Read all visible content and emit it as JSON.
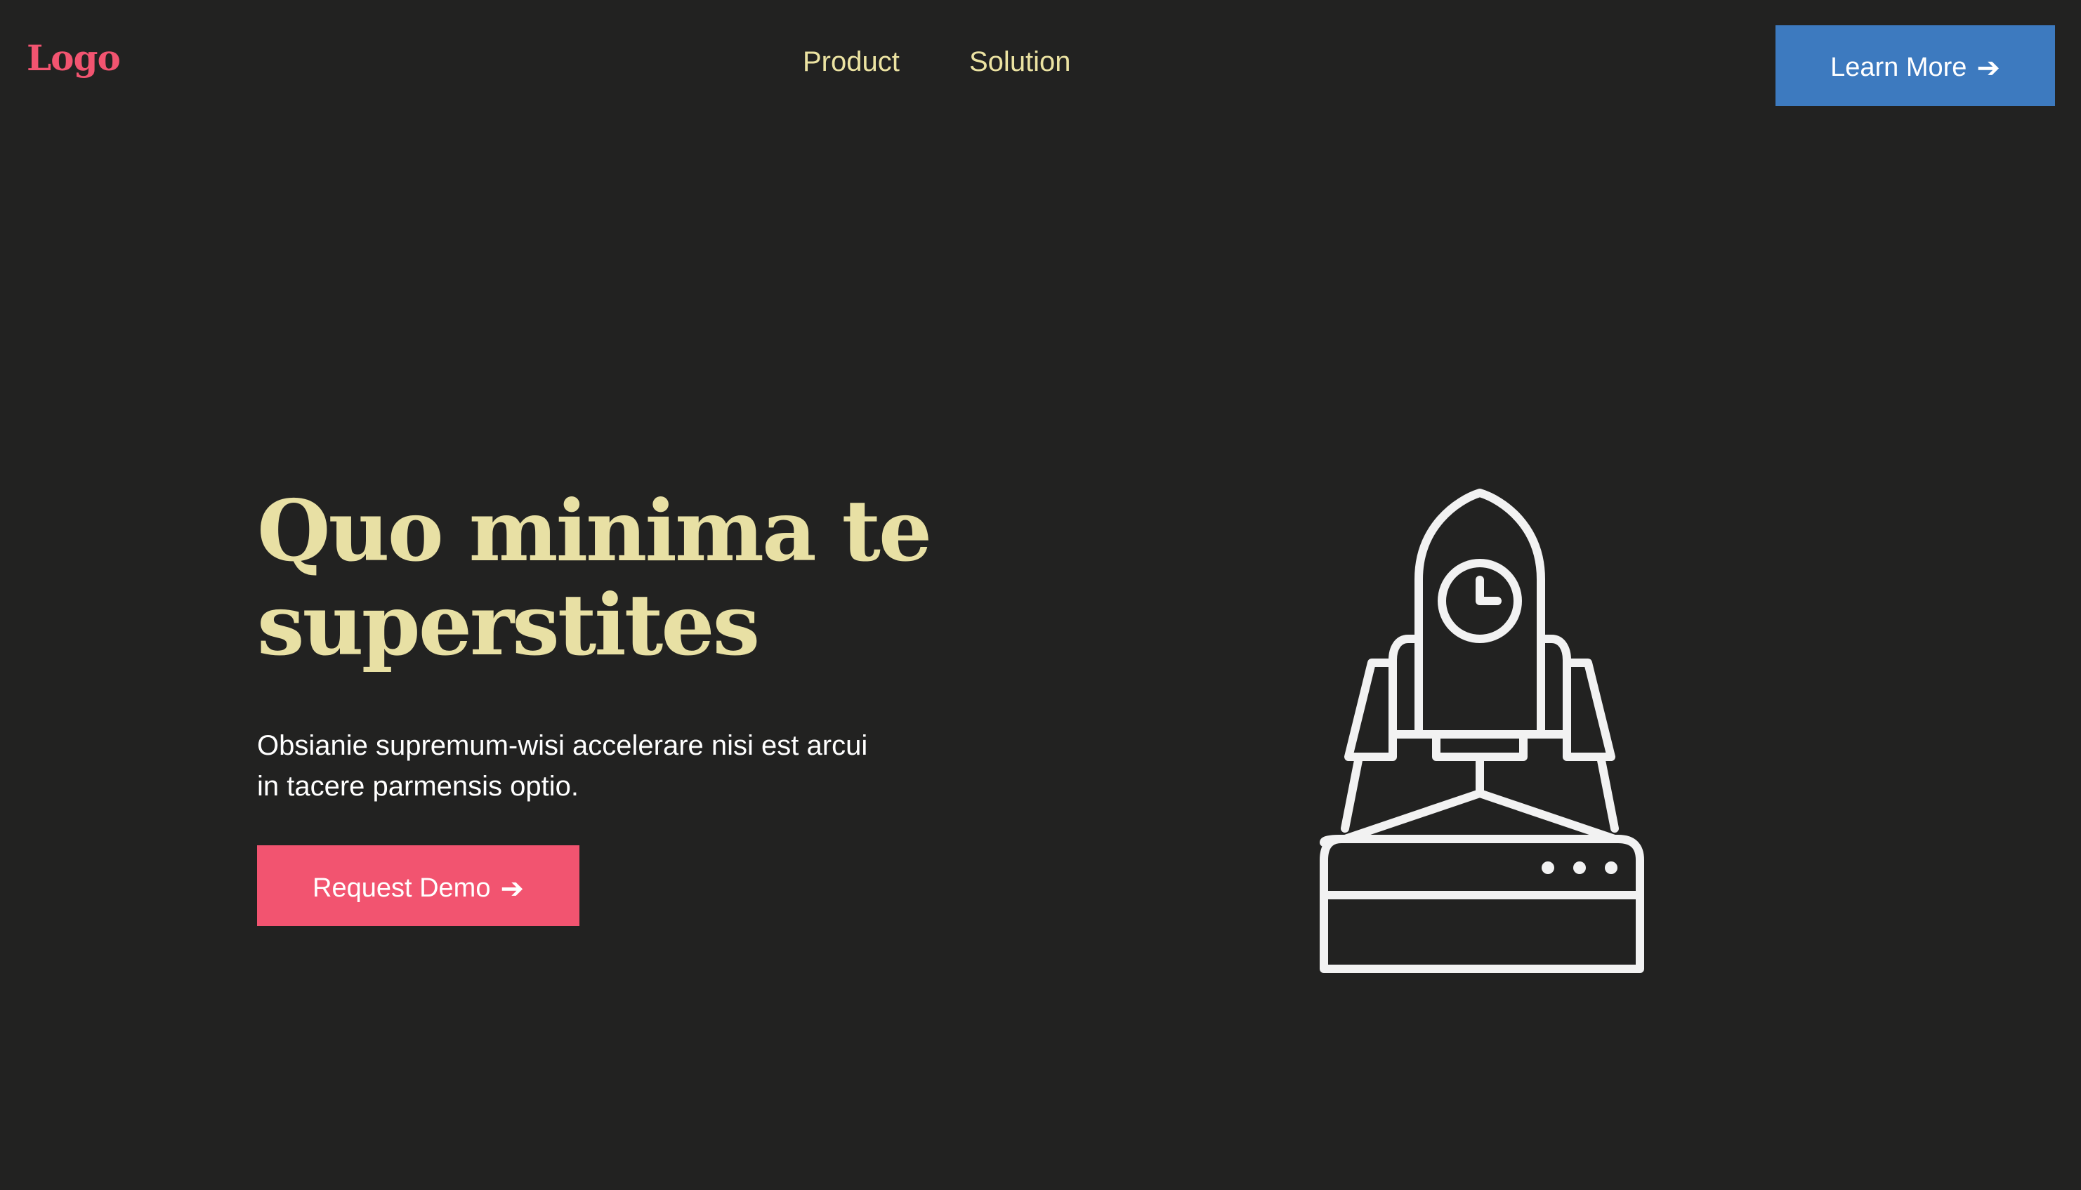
{
  "header": {
    "logo": "Logo",
    "nav": [
      {
        "label": "Product"
      },
      {
        "label": "Solution"
      }
    ],
    "cta": {
      "label": "Learn More",
      "arrow": "➔",
      "color": "#3d7abf"
    }
  },
  "hero": {
    "title": "Quo minima te superstites",
    "subtitle": "Obsianie supremum-wisi accelerare nisi est arcui in tacere parmensis optio.",
    "cta": {
      "label": "Request Demo",
      "arrow": "➔",
      "color": "#f25470"
    },
    "illustration": "rocket-launch-icon"
  },
  "colors": {
    "background": "#222221",
    "accent": "#f25470",
    "headline": "#e8e0a4",
    "nav": "#ece3a2",
    "primary_button": "#3d7abf"
  }
}
